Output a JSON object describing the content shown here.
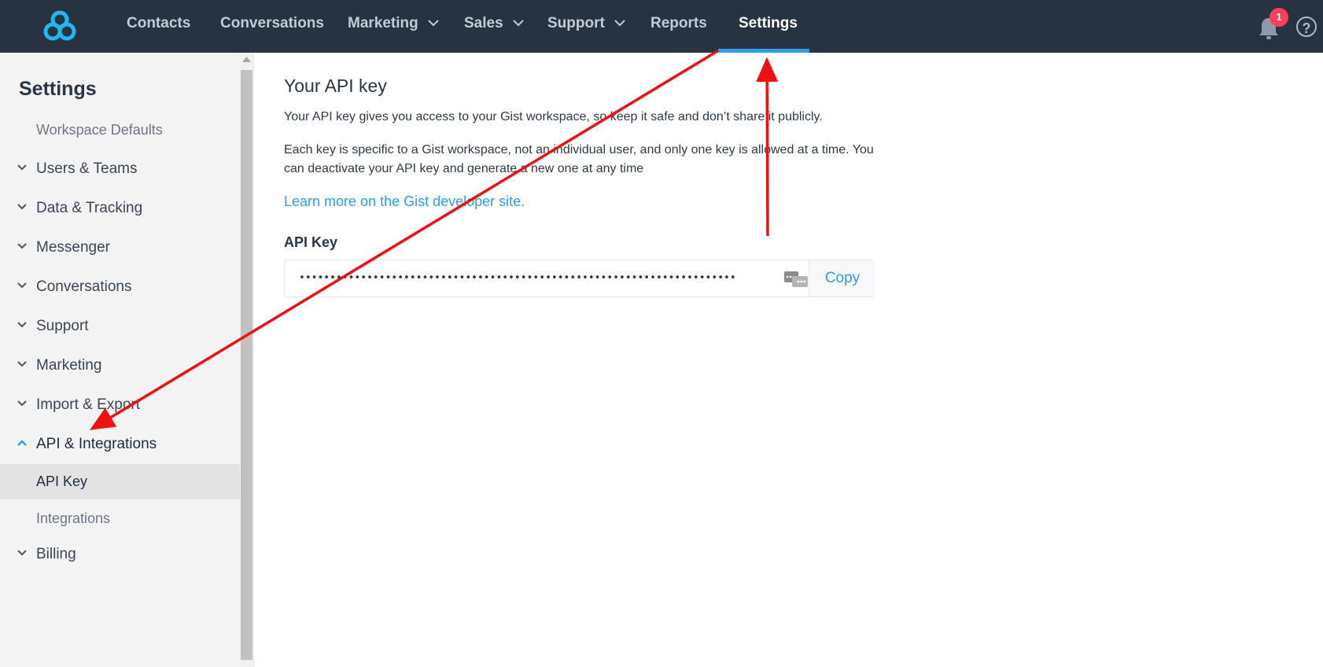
{
  "topnav": {
    "items": [
      {
        "label": "Contacts",
        "dropdown": false
      },
      {
        "label": "Conversations",
        "dropdown": false
      },
      {
        "label": "Marketing",
        "dropdown": true
      },
      {
        "label": "Sales",
        "dropdown": true
      },
      {
        "label": "Support",
        "dropdown": true
      },
      {
        "label": "Reports",
        "dropdown": false
      },
      {
        "label": "Settings",
        "dropdown": false,
        "active": true
      }
    ],
    "notifications_count": "1",
    "help_label": "?"
  },
  "sidebar": {
    "title": "Settings",
    "items": [
      {
        "label": "Workspace Defaults",
        "type": "sub"
      },
      {
        "label": "Users & Teams",
        "type": "group",
        "expanded": false
      },
      {
        "label": "Data & Tracking",
        "type": "group",
        "expanded": false
      },
      {
        "label": "Messenger",
        "type": "group",
        "expanded": false
      },
      {
        "label": "Conversations",
        "type": "group",
        "expanded": false
      },
      {
        "label": "Support",
        "type": "group",
        "expanded": false
      },
      {
        "label": "Marketing",
        "type": "group",
        "expanded": false
      },
      {
        "label": "Import & Export",
        "type": "group",
        "expanded": false
      },
      {
        "label": "API & Integrations",
        "type": "group",
        "expanded": true
      },
      {
        "label": "API Key",
        "type": "sub",
        "selected": true
      },
      {
        "label": "Integrations",
        "type": "sub"
      },
      {
        "label": "Billing",
        "type": "group",
        "expanded": false
      }
    ]
  },
  "main": {
    "title": "Your API key",
    "paragraph1": "Your API key gives you access to your Gist workspace, so keep it safe and don’t share it publicly.",
    "paragraph2": "Each key is specific to a Gist workspace, not an individual user, and only one key is allowed at a time. You can deactivate your API key and generate a new one at any time",
    "link_text": "Learn more on the Gist developer site.",
    "field_label": "API Key",
    "api_key_value": "•••••••••••••••••••••••••••••••••••••••••••••••••••••••••••••••••••••••",
    "copy_label": "Copy"
  },
  "colors": {
    "topbar": "#273340",
    "accent": "#2e9ceb",
    "badge": "#ff3f5b",
    "annotation_arrow": "#ee1111"
  }
}
